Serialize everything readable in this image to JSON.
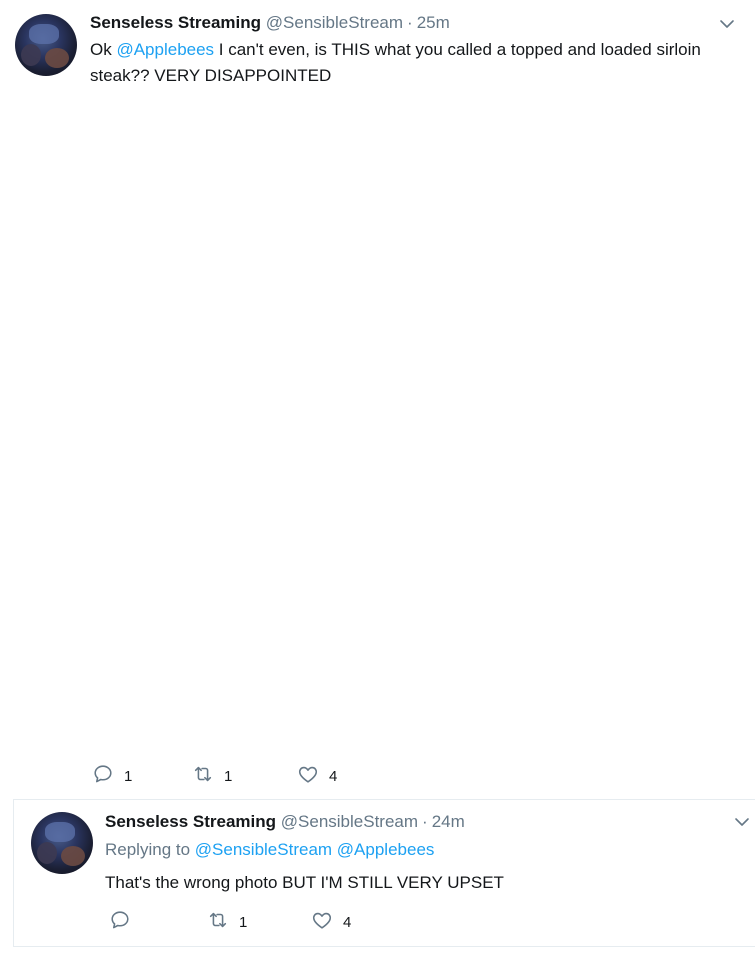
{
  "tweets": [
    {
      "author_name": "Senseless Streaming",
      "handle": "@SensibleStream",
      "dot": "·",
      "time": "25m",
      "text_before": "Ok ",
      "mention": "@Applebees",
      "text_after": " I can't even, is THIS what you called a topped and loaded sirloin steak?? VERY DISAPPOINTED",
      "reply_count": "1",
      "retweet_count": "1",
      "like_count": "4"
    },
    {
      "author_name": "Senseless Streaming",
      "handle": "@SensibleStream",
      "dot": "·",
      "time": "24m",
      "replying_to_label": "Replying to",
      "replying_to_1": "@SensibleStream",
      "replying_to_2": "@Applebees",
      "text": "That's the wrong photo BUT I'M STILL VERY UPSET",
      "reply_count": "",
      "retweet_count": "1",
      "like_count": "4"
    }
  ],
  "icons": {
    "reply": "reply-icon",
    "retweet": "retweet-icon",
    "like": "heart-icon",
    "more": "chevron-down-icon"
  },
  "colors": {
    "link": "#1da1f2",
    "secondary_text": "#657786",
    "icon": "#657786"
  }
}
